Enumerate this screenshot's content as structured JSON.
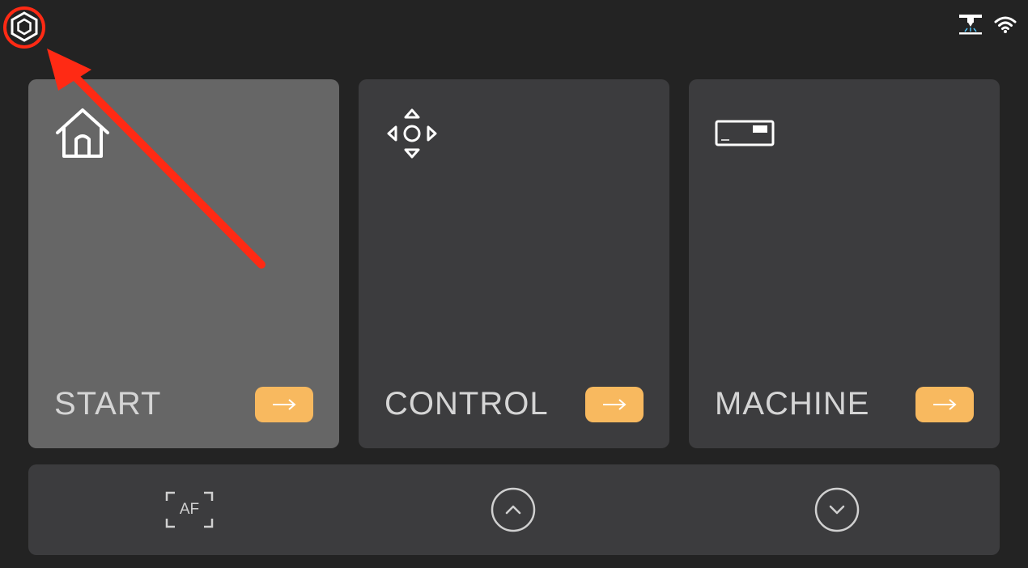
{
  "cards": [
    {
      "label": "START",
      "icon": "home-icon",
      "active": true
    },
    {
      "label": "CONTROL",
      "icon": "move-arrows-icon",
      "active": false
    },
    {
      "label": "MACHINE",
      "icon": "machine-icon",
      "active": false
    }
  ],
  "bottom_bar": {
    "autofocus_label": "AF"
  },
  "colors": {
    "background": "#232323",
    "card": "#3c3c3e",
    "card_active": "#666666",
    "accent": "#f8b95f",
    "annotation": "#ff2a14"
  }
}
